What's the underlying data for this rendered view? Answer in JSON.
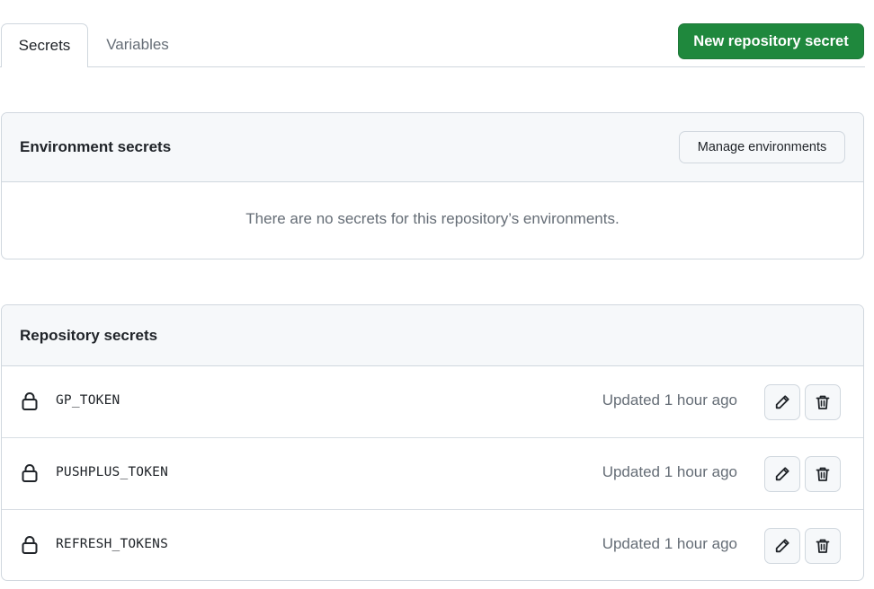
{
  "tabs": [
    {
      "label": "Secrets",
      "active": true
    },
    {
      "label": "Variables",
      "active": false
    }
  ],
  "new_secret_button": "New repository secret",
  "environment_secrets": {
    "title": "Environment secrets",
    "manage_button": "Manage environments",
    "empty_message": "There are no secrets for this repository’s environments."
  },
  "repository_secrets": {
    "title": "Repository secrets",
    "items": [
      {
        "name": "GP_TOKEN",
        "updated": "Updated 1 hour ago"
      },
      {
        "name": "PUSHPLUS_TOKEN",
        "updated": "Updated 1 hour ago"
      },
      {
        "name": "REFRESH_TOKENS",
        "updated": "Updated 1 hour ago"
      }
    ]
  },
  "icons": {
    "row_icon": "lock-icon",
    "edit": "pencil-icon",
    "delete": "trash-icon"
  },
  "colors": {
    "primary_button": "#1f883d",
    "border": "#d0d7de",
    "header_bg": "#f6f8fa",
    "muted_text": "#656d76"
  }
}
